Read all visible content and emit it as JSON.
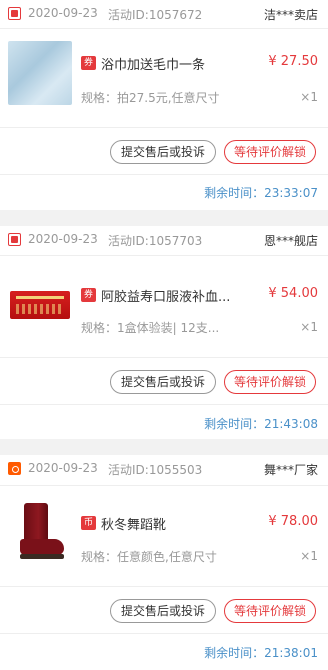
{
  "colors": {
    "price_red": "#e4393c",
    "timer_blue": "#4a90c8",
    "muted_gray": "#999999",
    "background": "#f2f2f2"
  },
  "orders": [
    {
      "platform_icon": "jd-icon",
      "date": "2020-09-23",
      "activity": "活动ID:1057672",
      "shop": "洁***卖店",
      "tag": "券",
      "product_title": "浴巾加送毛巾一条",
      "price": "¥ 27.50",
      "spec": "规格：拍27.5元,任意尺寸",
      "quantity": "×1",
      "complain_label": "提交售后或投诉",
      "review_label": "等待评价解锁",
      "timer_label": "剩余时间：",
      "timer_value": "23:33:07"
    },
    {
      "platform_icon": "jd-icon",
      "date": "2020-09-23",
      "activity": "活动ID:1057703",
      "shop": "恩***舰店",
      "tag": "券",
      "product_title": "阿胶益寿口服液补血...",
      "price": "¥ 54.00",
      "spec": "规格：1盒体验装| 12支...",
      "quantity": "×1",
      "complain_label": "提交售后或投诉",
      "review_label": "等待评价解锁",
      "timer_label": "剩余时间：",
      "timer_value": "21:43:08"
    },
    {
      "platform_icon": "taobao-icon",
      "date": "2020-09-23",
      "activity": "活动ID:1055503",
      "shop": "舞***厂家",
      "tag": "币",
      "product_title": "秋冬舞蹈靴",
      "price": "¥ 78.00",
      "spec": "规格：任意颜色,任意尺寸",
      "quantity": "×1",
      "complain_label": "提交售后或投诉",
      "review_label": "等待评价解锁",
      "timer_label": "剩余时间：",
      "timer_value": "21:38:01"
    }
  ]
}
